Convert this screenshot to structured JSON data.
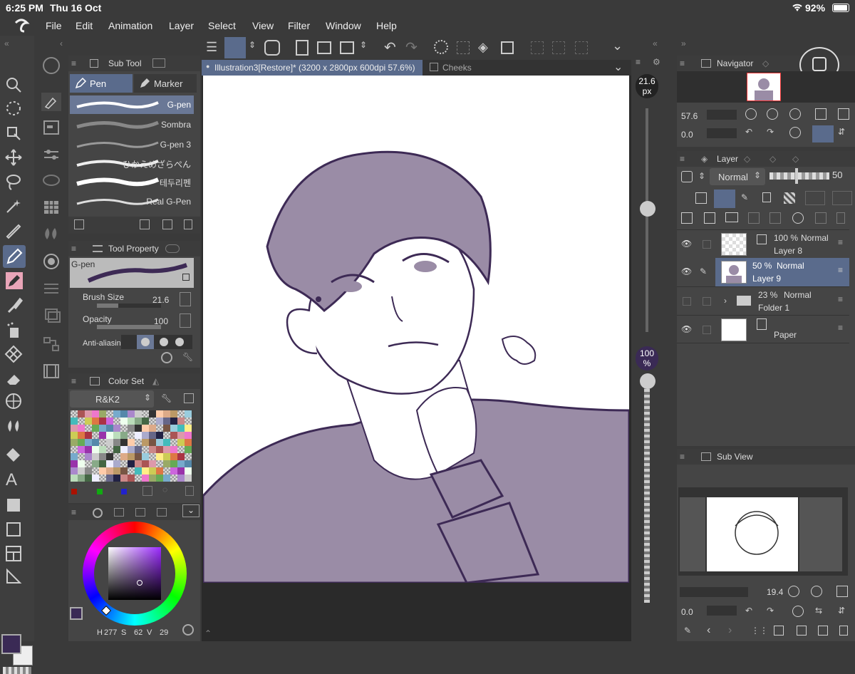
{
  "status": {
    "time": "6:25 PM",
    "date": "Thu 16 Oct",
    "battery": "92%"
  },
  "menu": [
    "File",
    "Edit",
    "Animation",
    "Layer",
    "Select",
    "View",
    "Filter",
    "Window",
    "Help"
  ],
  "subtool": {
    "title": "Sub Tool",
    "tabs": [
      "Pen",
      "Marker"
    ],
    "brushes": [
      "G-pen",
      "Sombra",
      "G-pen 3",
      "ひかえめざらぺん",
      "테두리펜",
      "Real G-Pen"
    ]
  },
  "tool_property": {
    "title": "Tool Property",
    "brush_name": "G-pen",
    "brush_size_label": "Brush Size",
    "brush_size_value": "21.6",
    "opacity_label": "Opacity",
    "opacity_value": "100",
    "antialias_label": "Anti-aliasing"
  },
  "color_set": {
    "title": "Color Set",
    "name": "R&K2"
  },
  "color_wheel": {
    "h_label": "H",
    "h": "277",
    "s_label": "S",
    "s": "62",
    "v_label": "V",
    "v": "29",
    "main_color": "#3a2a55"
  },
  "canvas": {
    "tab_title": "Illustration3[Restore]* (3200 x 2800px 600dpi 57.6%)",
    "tab2": "Cheeks"
  },
  "brush_slider": {
    "size_value": "21.6",
    "size_unit": "px",
    "opacity_value": "100",
    "opacity_unit": "%"
  },
  "navigator": {
    "title": "Navigator",
    "zoom": "57.6",
    "rotate": "0.0"
  },
  "layer": {
    "title": "Layer",
    "blend": "Normal",
    "opacity": "50",
    "layers": [
      {
        "opacity": "100 %",
        "mode": "Normal",
        "name": "Layer 8"
      },
      {
        "opacity": "50 %",
        "mode": "Normal",
        "name": "Layer 9"
      },
      {
        "opacity": "23 %",
        "mode": "Normal",
        "name": "Folder 1"
      },
      {
        "opacity": "",
        "mode": "",
        "name": "Paper"
      }
    ]
  },
  "subview": {
    "title": "Sub View",
    "zoom": "19.4",
    "rotate": "0.0"
  },
  "colors": {
    "accent": "#5a6b8c",
    "line_purple": "#3d2a55",
    "fill_purple": "#9a8ca6"
  }
}
